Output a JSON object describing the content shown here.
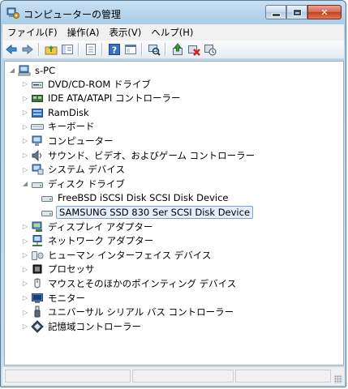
{
  "window": {
    "title": "コンピューターの管理"
  },
  "menu": [
    "ファイル(F)",
    "操作(A)",
    "表示(V)",
    "ヘルプ(H)"
  ],
  "tree": {
    "root": "s-PC",
    "items": [
      {
        "label": "DVD/CD-ROM ドライブ",
        "icon": "dvd-drive-icon",
        "expanded": false,
        "depth": 1
      },
      {
        "label": "IDE ATA/ATAPI コントローラー",
        "icon": "ide-controller-icon",
        "expanded": false,
        "depth": 1
      },
      {
        "label": "RamDisk",
        "icon": "ramdisk-icon",
        "expanded": false,
        "depth": 1
      },
      {
        "label": "キーボード",
        "icon": "keyboard-icon",
        "expanded": false,
        "depth": 1
      },
      {
        "label": "コンピューター",
        "icon": "computer-icon",
        "expanded": false,
        "depth": 1
      },
      {
        "label": "サウンド、ビデオ、およびゲーム コントローラー",
        "icon": "speaker-icon",
        "expanded": false,
        "depth": 1
      },
      {
        "label": "システム デバイス",
        "icon": "system-device-icon",
        "expanded": false,
        "depth": 1
      },
      {
        "label": "ディスク ドライブ",
        "icon": "disk-drive-icon",
        "expanded": true,
        "depth": 1
      },
      {
        "label": "FreeBSD iSCSI Disk SCSI Disk Device",
        "icon": "disk-icon",
        "depth": 2
      },
      {
        "label": "SAMSUNG SSD 830 Ser SCSI Disk Device",
        "icon": "disk-icon",
        "depth": 2,
        "selected": true
      },
      {
        "label": "ディスプレイ アダプター",
        "icon": "display-adapter-icon",
        "expanded": false,
        "depth": 1
      },
      {
        "label": "ネットワーク アダプター",
        "icon": "network-adapter-icon",
        "expanded": false,
        "depth": 1
      },
      {
        "label": "ヒューマン インターフェイス デバイス",
        "icon": "hid-icon",
        "expanded": false,
        "depth": 1
      },
      {
        "label": "プロセッサ",
        "icon": "processor-icon",
        "expanded": false,
        "depth": 1
      },
      {
        "label": "マウスとそのほかのポインティング デバイス",
        "icon": "mouse-icon",
        "expanded": false,
        "depth": 1
      },
      {
        "label": "モニター",
        "icon": "monitor-icon",
        "expanded": false,
        "depth": 1
      },
      {
        "label": "ユニバーサル シリアル バス コントローラー",
        "icon": "usb-icon",
        "expanded": false,
        "depth": 1
      },
      {
        "label": "記憶域コントローラー",
        "icon": "storage-controller-icon",
        "expanded": false,
        "depth": 1
      }
    ]
  },
  "toolbar": [
    "back-arrow-icon",
    "forward-arrow-icon",
    "up-folder-icon",
    "show-hide-tree-icon",
    "properties-icon",
    "help-icon",
    "view-pane-icon",
    "scan-hardware-icon",
    "update-driver-icon",
    "uninstall-icon",
    "disable-device-icon"
  ],
  "colors": {
    "selection": "#e3eefa",
    "selection_border": "#7da2ce"
  }
}
